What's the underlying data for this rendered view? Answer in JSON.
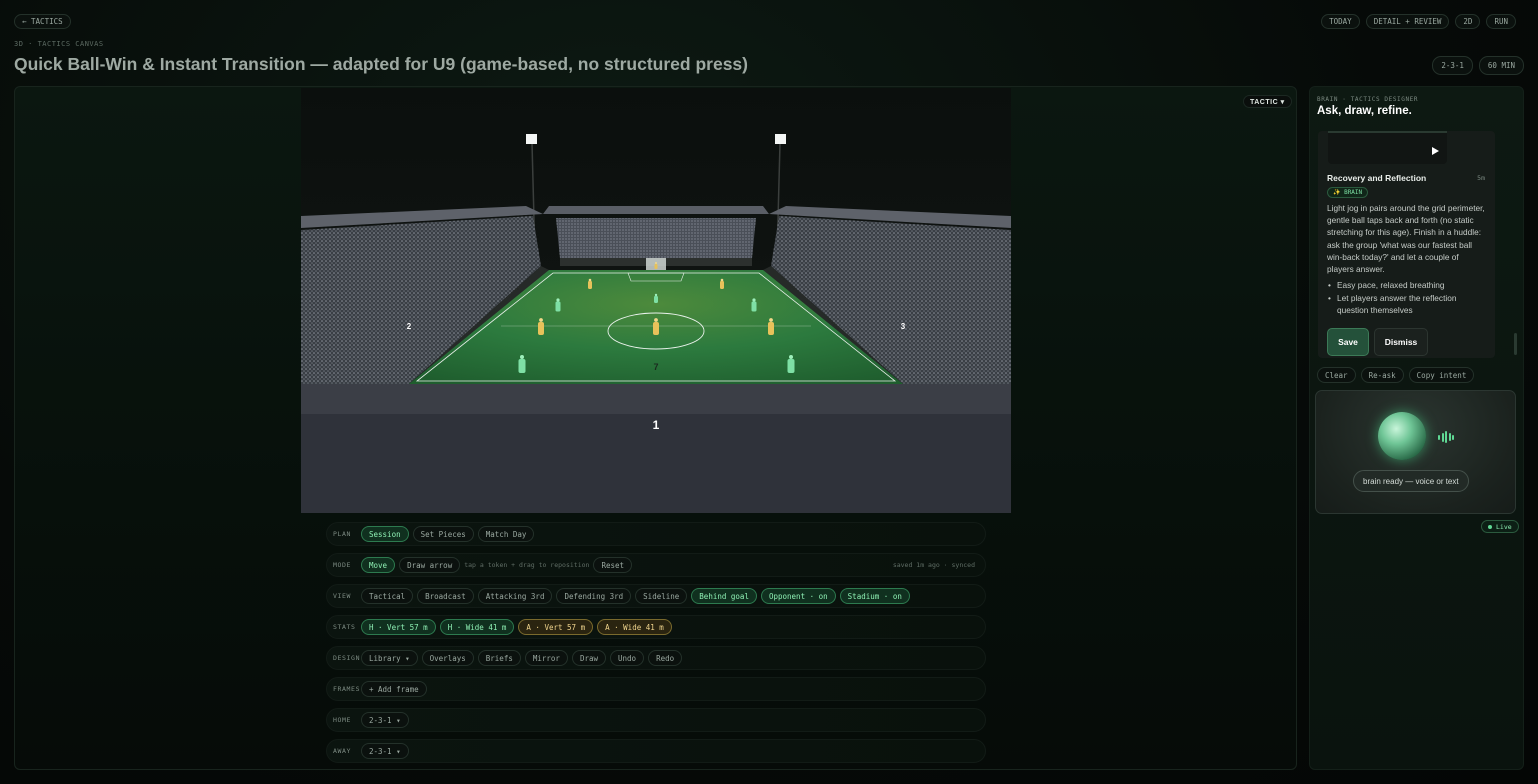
{
  "nav": {
    "back_label": "← TACTICS",
    "breadcrumb": "3D · TACTICS CANVAS",
    "top_buttons": [
      "TODAY",
      "DETAIL + REVIEW",
      "2D",
      "RUN"
    ]
  },
  "page": {
    "title": "Quick Ball-Win & Instant Transition — adapted for U9 (game-based, no structured press)",
    "formation_tag": "2-3-1",
    "duration_tag": "60 MIN"
  },
  "scene": {
    "tactic_button": "TACTIC ▾",
    "stand_labels": {
      "bottom": "1",
      "left": "2",
      "right": "3",
      "field": "7"
    }
  },
  "controls": {
    "plan": {
      "label": "PLAN",
      "options": [
        "Session",
        "Set Pieces",
        "Match Day"
      ]
    },
    "mode": {
      "label": "MODE",
      "options": [
        "Move",
        "Draw arrow"
      ],
      "hint": "tap a token + drag to reposition",
      "reset": "Reset",
      "saved": "saved 1m ago · synced"
    },
    "view": {
      "label": "VIEW",
      "options": [
        "Tactical",
        "Broadcast",
        "Attacking 3rd",
        "Defending 3rd",
        "Sideline",
        "Behind goal",
        "Opponent · on",
        "Stadium · on"
      ]
    },
    "stats": {
      "label": "STATS",
      "options": [
        "H · Vert 57 m",
        "H · Wide 41 m",
        "A · Vert 57 m",
        "A · Wide 41 m"
      ]
    },
    "design": {
      "label": "DESIGN",
      "options": [
        "Library ▾",
        "Overlays",
        "Briefs",
        "Mirror",
        "Draw",
        "Undo",
        "Redo"
      ]
    },
    "frames": {
      "label": "FRAMES",
      "add": "+ Add frame"
    },
    "home": {
      "label": "HOME",
      "value": "2-3-1 ▾"
    },
    "away": {
      "label": "AWAY",
      "value": "2-3-1 ▾"
    }
  },
  "brain": {
    "kicker": "BRAIN · TACTICS DESIGNER",
    "title": "Ask, draw, refine.",
    "card": {
      "heading": "Recovery and Reflection",
      "duration": "5m",
      "badge": "✨ BRAIN",
      "body": "Light jog in pairs around the grid perimeter, gentle ball taps back and forth (no static stretching for this age). Finish in a huddle: ask the group 'what was our fastest ball win-back today?' and let a couple of players answer.",
      "bullets": [
        "Easy pace, relaxed breathing",
        "Let players answer the reflection question themselves"
      ],
      "save": "Save",
      "dismiss": "Dismiss"
    },
    "actions": [
      "Clear",
      "Re-ask",
      "Copy intent"
    ],
    "voice_status": "brain ready — voice or text",
    "live": "Live"
  },
  "colors": {
    "accent": "#5fd894",
    "home": "#7ee0a5",
    "away": "#e8c25a",
    "pitch": "#2c7a3e"
  }
}
